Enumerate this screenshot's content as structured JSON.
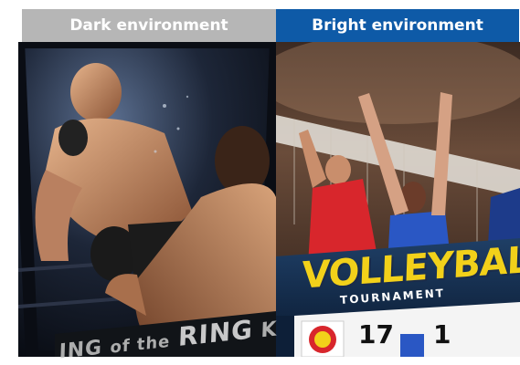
{
  "panels": {
    "left_label": "Dark environment",
    "right_label": "Bright environment"
  },
  "left_scene": {
    "ring_word_1": "ING",
    "ring_word_2": "of the",
    "ring_word_3": "RING",
    "ring_word_4": "K"
  },
  "right_scene": {
    "title": "VOLLEYBALL",
    "subtitle": "TOURNAMENT",
    "score_left": "17",
    "score_right": "1"
  },
  "colors": {
    "dark_header": "#b6b6b6",
    "bright_header": "#0e5aa7",
    "title_yellow": "#f2d11a"
  }
}
